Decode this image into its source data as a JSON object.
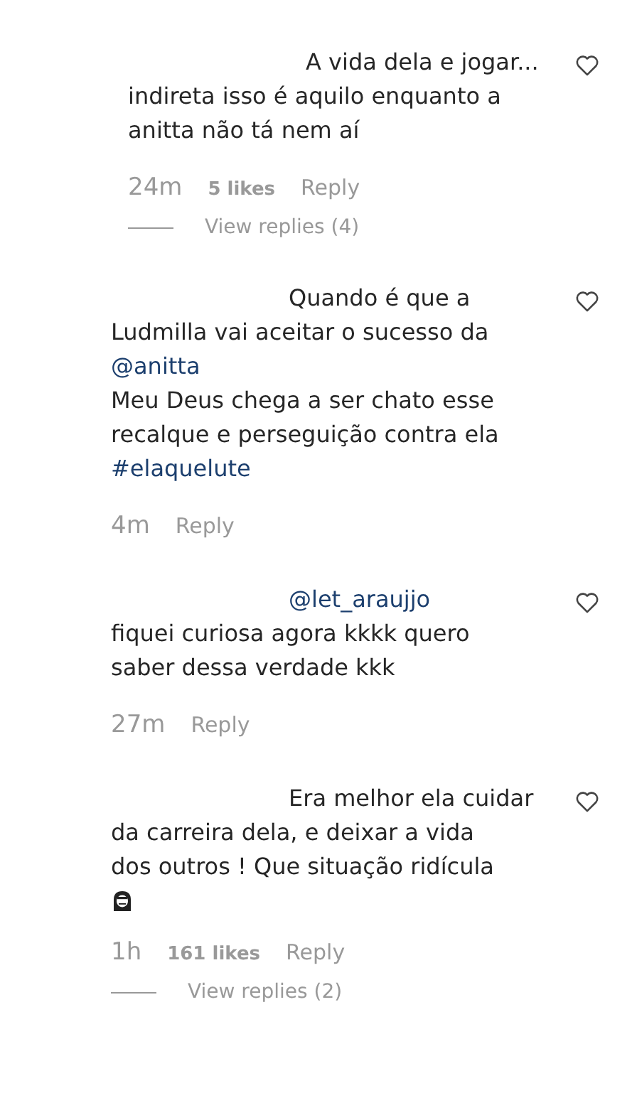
{
  "comments": [
    {
      "lines": [
        {
          "kind": "text",
          "text": "A vida dela e jogar..."
        },
        {
          "kind": "text",
          "text": "indireta isso é aquilo enquanto a"
        },
        {
          "kind": "text",
          "text": "anitta não tá nem aí"
        }
      ],
      "liked": false,
      "time": "24m",
      "likes": "5 likes",
      "reply": "Reply",
      "view_replies": "View replies (4)"
    },
    {
      "lines": [
        {
          "kind": "text",
          "text": "Quando é que a"
        },
        {
          "kind": "text",
          "text": "Ludmilla vai aceitar o sucesso da"
        },
        {
          "kind": "mention",
          "text": "@anitta"
        },
        {
          "kind": "text",
          "text": "Meu Deus chega a ser chato esse"
        },
        {
          "kind": "text",
          "text": "recalque e perseguição contra ela"
        },
        {
          "kind": "mention",
          "text": "#elaquelute"
        }
      ],
      "liked": false,
      "time": "4m",
      "reply": "Reply"
    },
    {
      "lines": [
        {
          "kind": "mention",
          "text": "@let_araujjo"
        },
        {
          "kind": "text",
          "text": "fiquei curiosa agora kkkk quero"
        },
        {
          "kind": "text",
          "text": "saber dessa verdade kkk"
        }
      ],
      "liked": false,
      "time": "27m",
      "reply": "Reply"
    },
    {
      "lines": [
        {
          "kind": "text",
          "text": "Era melhor ela cuidar"
        },
        {
          "kind": "text",
          "text": "da carreira dela, e deixar a vida"
        },
        {
          "kind": "text",
          "text": "dos outros ! Que situação ridícula"
        },
        {
          "kind": "emoji"
        }
      ],
      "liked": false,
      "time": "1h",
      "likes": "161 likes",
      "reply": "Reply",
      "view_replies": "View replies (2)"
    }
  ]
}
